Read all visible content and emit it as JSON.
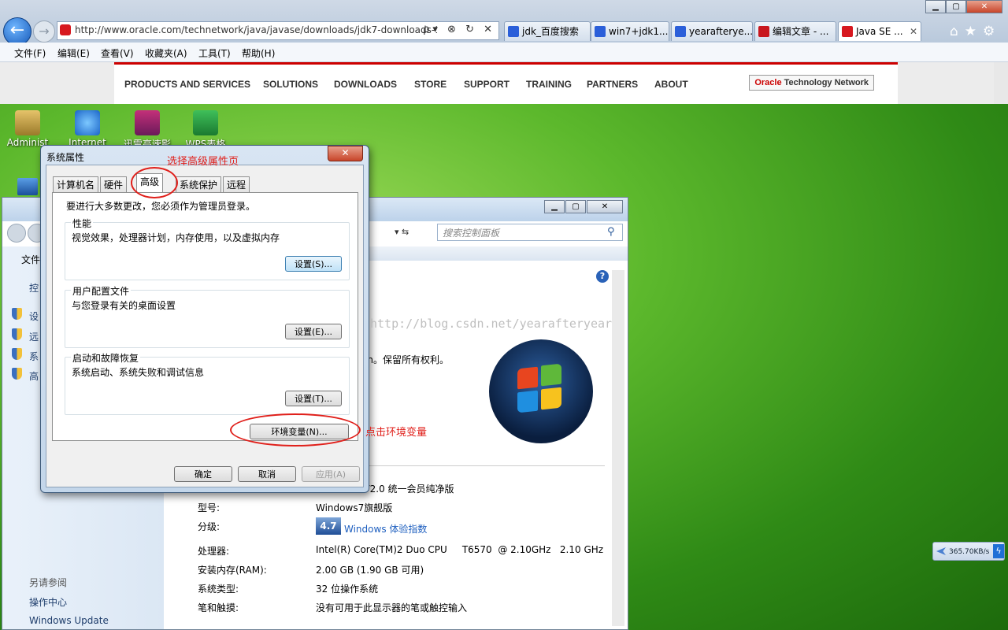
{
  "browser": {
    "address_url": "http://www.oracle.com/technetwork/java/javase/downloads/jdk7-downloads-1",
    "address_tools": "ρ▾ ⊗ ↻ ✕",
    "tabs": [
      "jdk_百度搜索",
      "win7+jdk1....",
      "yearafterye...",
      "编辑文章 - ...",
      "Java SE ..."
    ],
    "menu": [
      "文件(F)",
      "编辑(E)",
      "查看(V)",
      "收藏夹(A)",
      "工具(T)",
      "帮助(H)"
    ]
  },
  "oracle_nav": {
    "items": [
      "PRODUCTS AND SERVICES",
      "SOLUTIONS",
      "DOWNLOADS",
      "STORE",
      "SUPPORT",
      "TRAINING",
      "PARTNERS",
      "ABOUT"
    ],
    "otn_brand": "Oracle",
    "otn_rest": "Technology Network"
  },
  "desktop": {
    "icons": [
      "Administ",
      "Internet",
      "迅雷高速影",
      "WPS表格"
    ]
  },
  "control_panel": {
    "search_placeholder": "搜索控制面板",
    "left_top": [
      "文件",
      "控",
      "设",
      "远",
      "系",
      "高"
    ],
    "see_also": "另请参阅",
    "links": [
      "操作中心",
      "Windows Update"
    ],
    "copyright": "on。保留所有权利。",
    "edition": "7 V2.0 统一会员纯净版",
    "rows": [
      {
        "label": "型号:",
        "value": "Windows7旗舰版"
      },
      {
        "label": "分级:",
        "value": "Windows 体验指数"
      },
      {
        "label": "处理器:",
        "value": "Intel(R) Core(TM)2 Duo CPU     T6570  @ 2.10GHz   2.10 GHz"
      },
      {
        "label": "安装内存(RAM):",
        "value": "2.00 GB (1.90 GB 可用)"
      },
      {
        "label": "系统类型:",
        "value": "32 位操作系统"
      },
      {
        "label": "笔和触摸:",
        "value": "没有可用于此显示器的笔或触控输入"
      }
    ],
    "rating": "4.7"
  },
  "dialog": {
    "title": "系统属性",
    "tabs": [
      "计算机名",
      "硬件",
      "高级",
      "系统保护",
      "远程"
    ],
    "admin_note": "要进行大多数更改，您必须作为管理员登录。",
    "groups": [
      {
        "title": "性能",
        "desc": "视觉效果，处理器计划，内存使用，以及虚拟内存",
        "button": "设置(S)..."
      },
      {
        "title": "用户配置文件",
        "desc": "与您登录有关的桌面设置",
        "button": "设置(E)..."
      },
      {
        "title": "启动和故障恢复",
        "desc": "系统启动、系统失败和调试信息",
        "button": "设置(T)..."
      }
    ],
    "env_button": "环境变量(N)...",
    "ok": "确定",
    "cancel": "取消",
    "apply": "应用(A)"
  },
  "annotations": {
    "select_tab": "选择高级属性页",
    "click_env": "点击环境变量"
  },
  "watermark": "http://blog.csdn.net/yearafteryear",
  "net_speed": "365.70KB/s"
}
